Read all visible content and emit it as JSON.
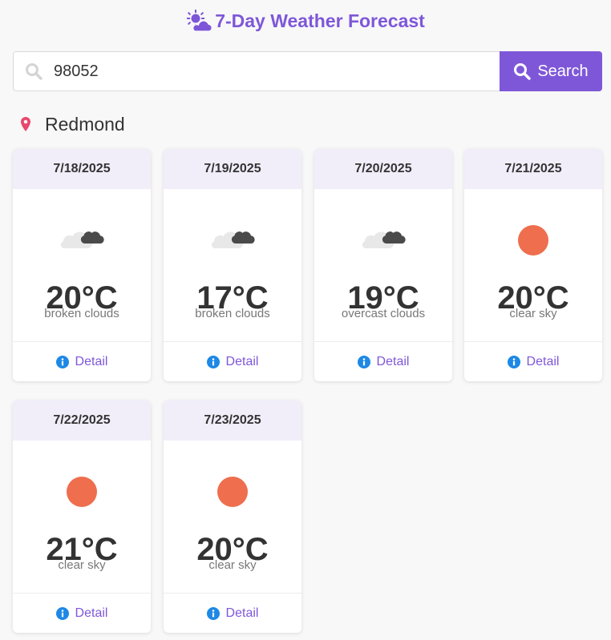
{
  "header": {
    "title": "7-Day Weather Forecast",
    "logo_icon": "sun-behind-cloud-icon"
  },
  "search": {
    "value": "98052",
    "button_label": "Search"
  },
  "location": {
    "name": "Redmond"
  },
  "colors": {
    "accent": "#7e57d9",
    "pin": "#e9476c",
    "sun": "#ee6e4e",
    "info": "#1e88e5"
  },
  "forecast": [
    {
      "date": "7/18/2025",
      "temp": "20°C",
      "desc": "broken clouds",
      "icon": "broken-clouds-icon",
      "detail": "Detail"
    },
    {
      "date": "7/19/2025",
      "temp": "17°C",
      "desc": "broken clouds",
      "icon": "broken-clouds-icon",
      "detail": "Detail"
    },
    {
      "date": "7/20/2025",
      "temp": "19°C",
      "desc": "overcast clouds",
      "icon": "overcast-clouds-icon",
      "detail": "Detail"
    },
    {
      "date": "7/21/2025",
      "temp": "20°C",
      "desc": "clear sky",
      "icon": "sun-icon",
      "detail": "Detail"
    },
    {
      "date": "7/22/2025",
      "temp": "21°C",
      "desc": "clear sky",
      "icon": "sun-icon",
      "detail": "Detail"
    },
    {
      "date": "7/23/2025",
      "temp": "20°C",
      "desc": "clear sky",
      "icon": "sun-icon",
      "detail": "Detail"
    }
  ]
}
